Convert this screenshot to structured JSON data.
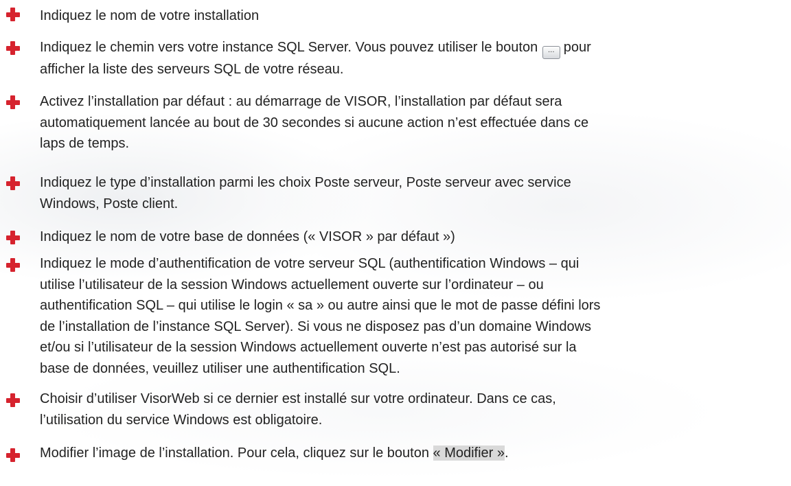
{
  "items": [
    {
      "text": "Indiquez le nom de votre installation"
    },
    {
      "text_before": "Indiquez le chemin vers votre instance SQL Server. Vous pouvez utiliser le bouton",
      "button_icon": "ellipsis-button-icon",
      "button_glyph": "...",
      "text_after": "pour\nafficher la liste des serveurs SQL de votre réseau."
    },
    {
      "text": "Activez l’installation par défaut : au démarrage de VISOR, l’installation par défaut sera\nautomatiquement lancée au bout de 30 secondes si aucune action n’est effectuée dans ce\nlaps de temps."
    },
    {
      "text": "Indiquez le type d’installation parmi les choix Poste serveur, Poste serveur avec service\nWindows, Poste client."
    },
    {
      "text": "Indiquez le nom de votre base de données (« VISOR » par défaut »)"
    },
    {
      "text": "Indiquez le mode d’authentification de votre serveur SQL (authentification Windows – qui\nutilise l’utilisateur de la session Windows actuellement ouverte sur l’ordinateur – ou\nauthentification SQL – qui utilise le login « sa » ou autre ainsi que le mot de passe défini lors\nde l’installation de l’instance SQL Server). Si vous ne disposez pas d’un domaine Windows\net/ou si l’utilisateur de la session Windows actuellement ouverte n’est pas autorisé sur la\nbase de données, veuillez utiliser une authentification SQL."
    },
    {
      "text": "Choisir d’utiliser VisorWeb si ce dernier est installé sur votre ordinateur. Dans ce cas,\nl’utilisation du service Windows est obligatoire."
    },
    {
      "text_before": "Modifier l’image de l’installation. Pour cela, cliquez sur le bouton",
      "highlight": "« Modifier »",
      "text_after": "."
    }
  ],
  "colors": {
    "bullet": "#d6232e",
    "text": "#222222",
    "highlight": "#d9d9d9"
  },
  "bullet_icon": "red-cross-icon"
}
